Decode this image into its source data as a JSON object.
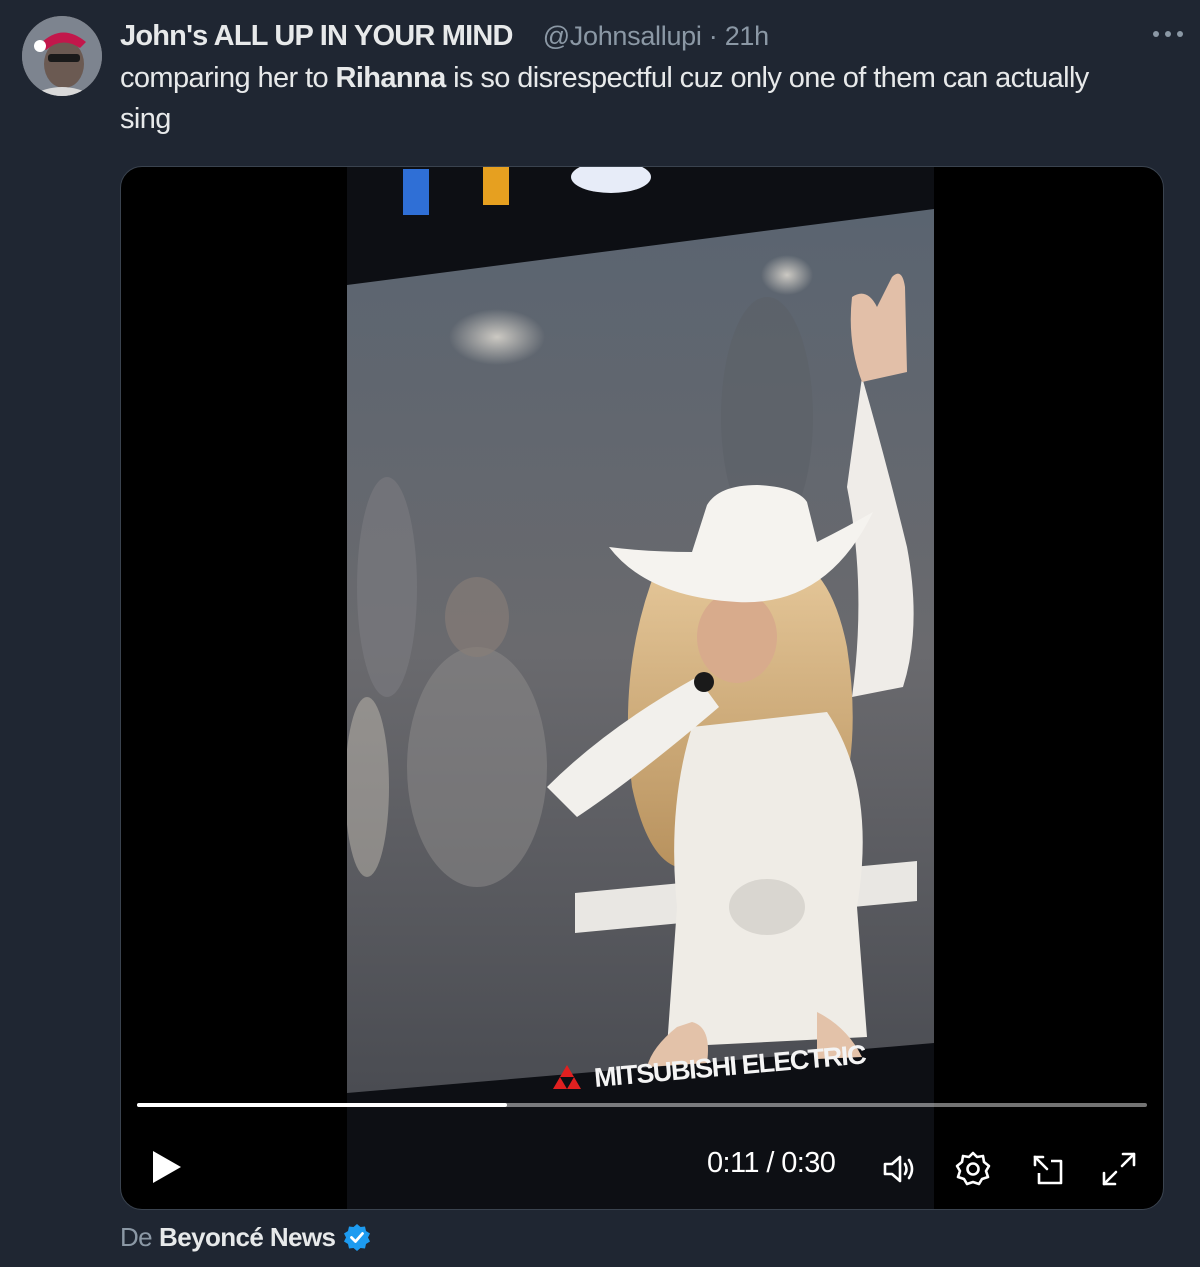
{
  "tweet": {
    "display_name": "John's ALL UP IN YOUR MIND",
    "handle": "@Johnsallupi",
    "separator": "·",
    "time": "21h",
    "text_before": "comparing her to ",
    "text_bold": "Rihanna",
    "text_after": " is so disrespectful cuz only one of them can actually sing",
    "more_icon": "ellipsis-icon",
    "avatar_icon": "avatar"
  },
  "video": {
    "sponsor_text": "MITSUBISHI ELECTRIC",
    "current_time": "0:11",
    "time_separator": " / ",
    "duration": "0:30",
    "progress_fraction": 0.366,
    "icons": [
      "play-icon",
      "volume-icon",
      "settings-icon",
      "dock-icon",
      "fullscreen-icon"
    ]
  },
  "attribution": {
    "prefix": "De",
    "source": "Beyoncé News",
    "verified_color": "#1d9bf0"
  },
  "colors": {
    "background": "#1f2632",
    "text": "#e7e9ea",
    "muted": "#8b98a5"
  }
}
